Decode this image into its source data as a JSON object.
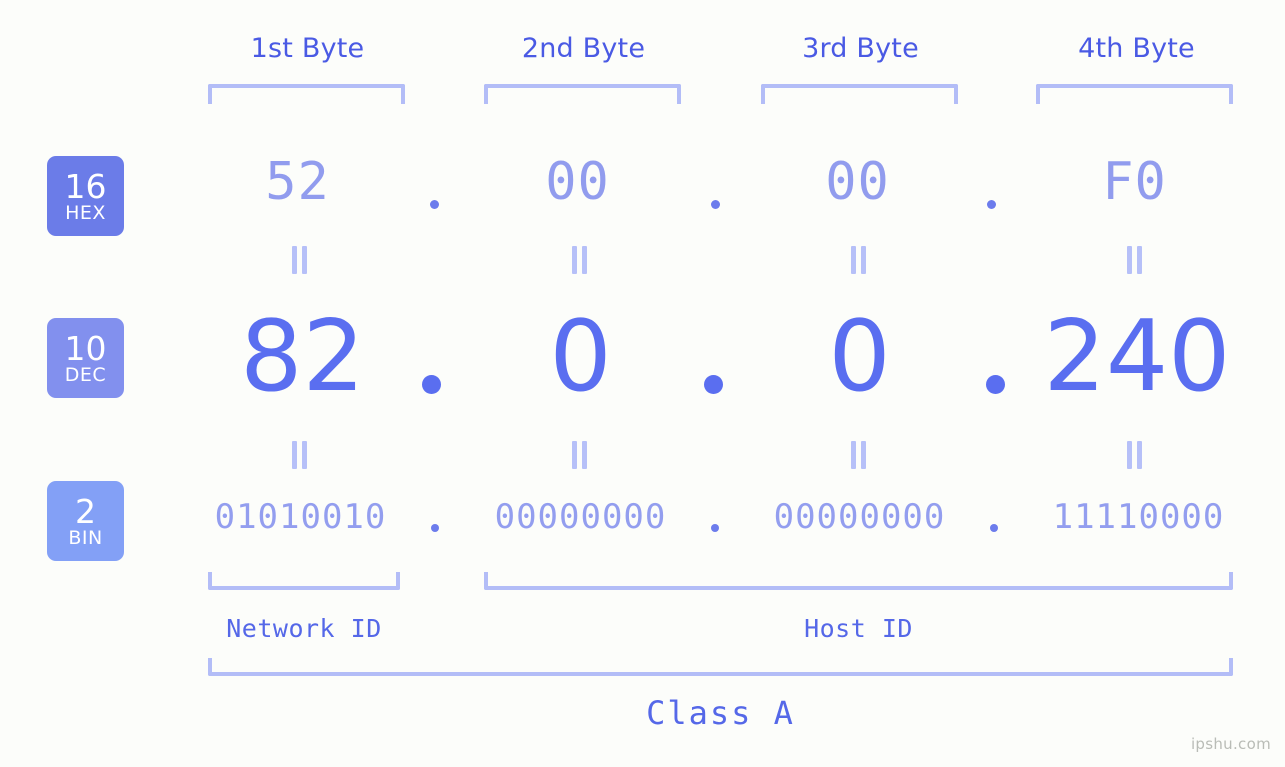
{
  "background_color": "#fcfdfa",
  "accent_colors": {
    "header_text": "#4a5ae4",
    "bracket": "#b3bdf7",
    "hex_badge": "#6b7ce8",
    "dec_badge": "#8290ee",
    "bin_badge": "#83a0f6",
    "hex_value": "#919cee",
    "dec_value": "#5a6ef0",
    "bin_value": "#939eef",
    "id_label": "#5568e8",
    "watermark": "#b9bcb6"
  },
  "byte_headers": [
    {
      "label": "1st Byte"
    },
    {
      "label": "2nd Byte"
    },
    {
      "label": "3rd Byte"
    },
    {
      "label": "4th Byte"
    }
  ],
  "rows": [
    {
      "radix": "16",
      "radix_name": "HEX",
      "values": [
        "52",
        "00",
        "00",
        "F0"
      ],
      "separator": "."
    },
    {
      "radix": "10",
      "radix_name": "DEC",
      "values": [
        "82",
        "0",
        "0",
        "240"
      ],
      "separator": "."
    },
    {
      "radix": "2",
      "radix_name": "BIN",
      "values": [
        "01010010",
        "00000000",
        "00000000",
        "11110000"
      ],
      "separator": "."
    }
  ],
  "equals_symbol": "||",
  "footer": {
    "network_id_label": "Network ID",
    "host_id_label": "Host ID",
    "class_label": "Class A"
  },
  "watermark": "ipshu.com"
}
